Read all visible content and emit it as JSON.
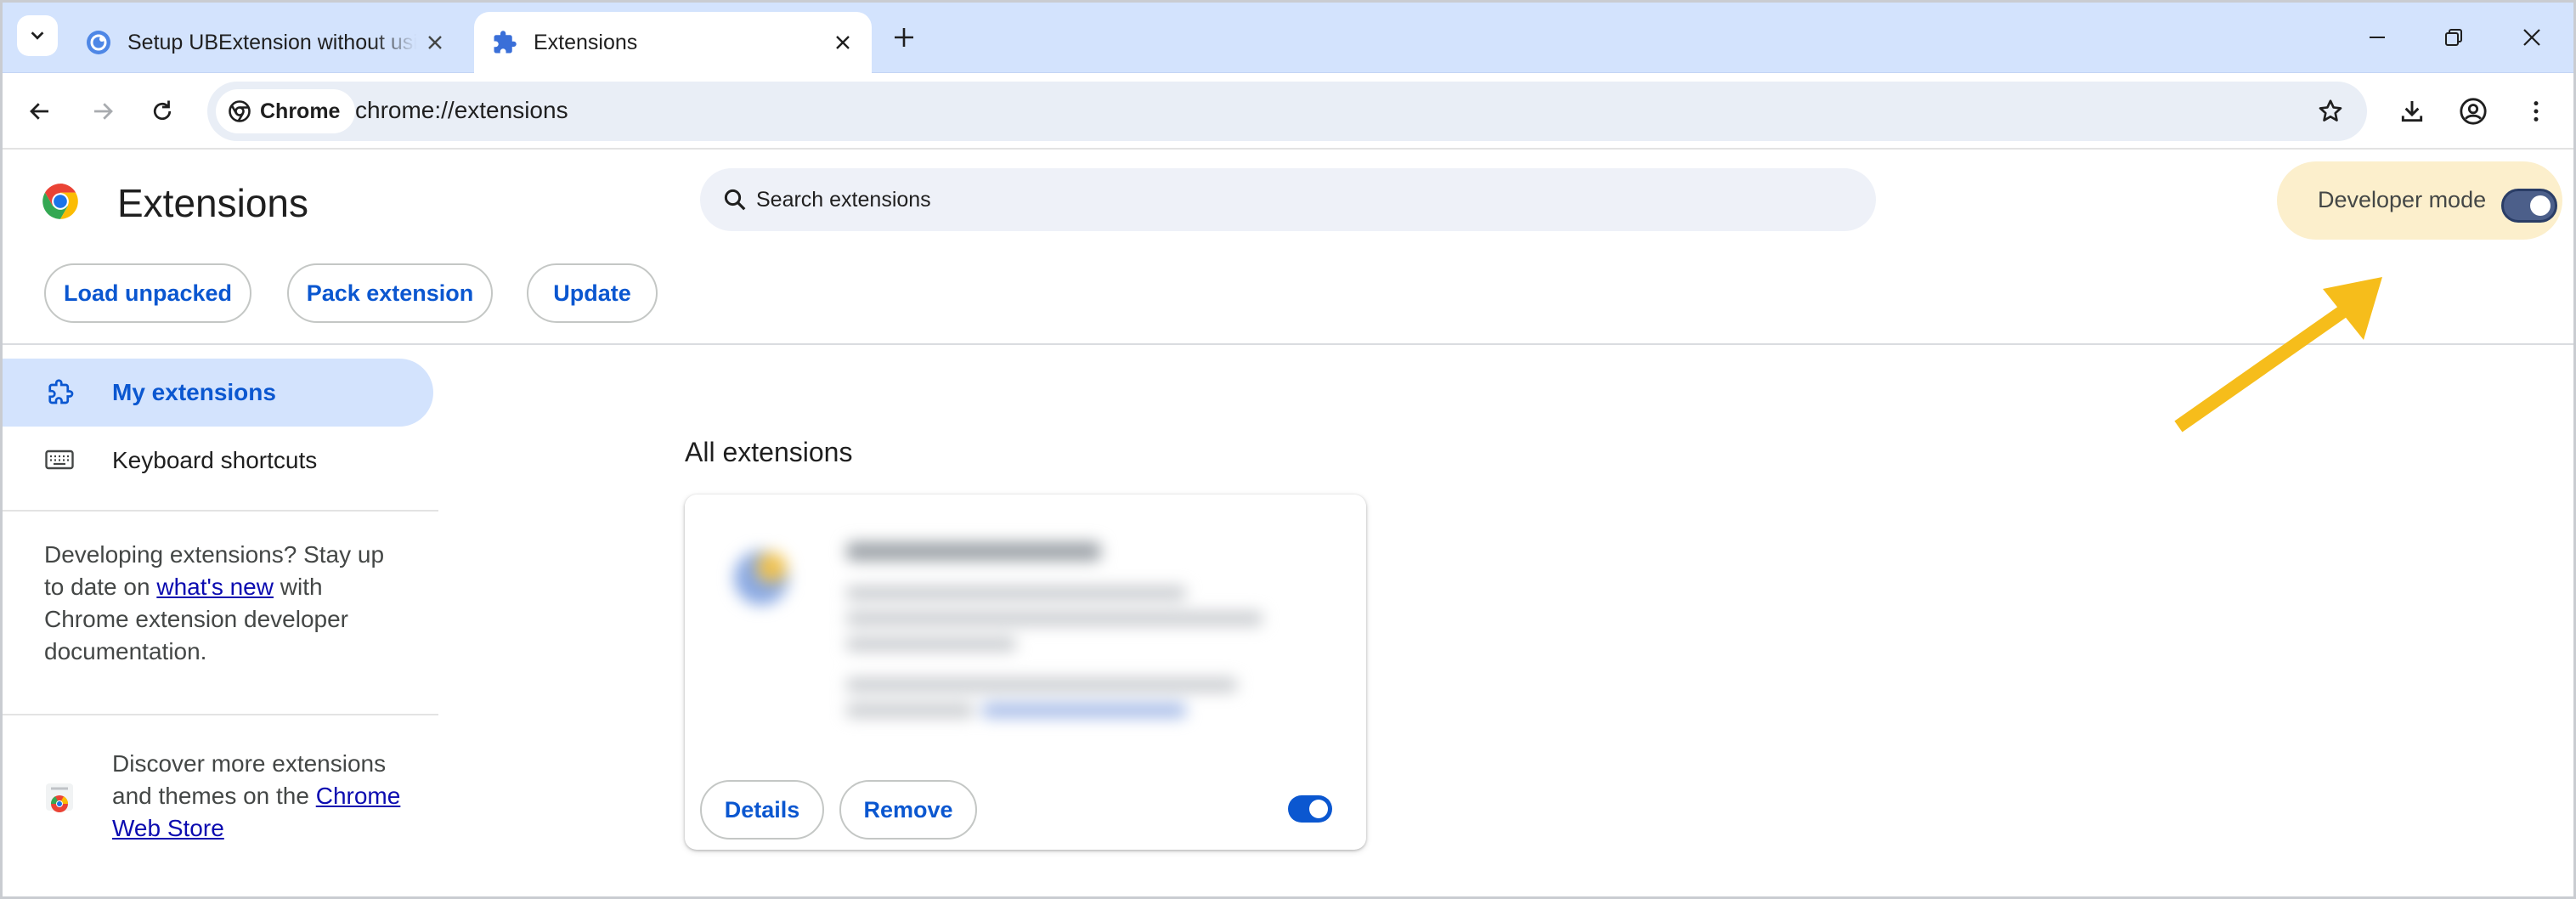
{
  "tabs": [
    {
      "title": "Setup UBExtension without using",
      "favicon": "ubextension-icon",
      "active": false
    },
    {
      "title": "Extensions",
      "favicon": "puzzle-icon",
      "active": true
    }
  ],
  "window_controls": [
    "minimize-icon",
    "restore-icon",
    "close-icon"
  ],
  "toolbar": {
    "chip_label": "Chrome",
    "url": "chrome://extensions"
  },
  "page": {
    "title": "Extensions",
    "search_placeholder": "Search extensions",
    "developer_mode_label": "Developer mode",
    "developer_mode_on": true,
    "buttons": {
      "load_unpacked": "Load unpacked",
      "pack_extension": "Pack extension",
      "update": "Update"
    }
  },
  "sidebar": {
    "items": [
      {
        "label": "My extensions",
        "icon": "puzzle-outline-icon",
        "active": true
      },
      {
        "label": "Keyboard shortcuts",
        "icon": "keyboard-icon",
        "active": false
      }
    ],
    "dev_text_1": "Developing extensions? Stay up to date on",
    "dev_link": "what's new",
    "dev_text_2": "with Chrome extension developer documentation.",
    "store_text": "Discover more extensions and themes on the",
    "store_link": "Chrome Web Store"
  },
  "main": {
    "section_title": "All extensions",
    "card": {
      "details_label": "Details",
      "remove_label": "Remove",
      "enabled": true
    }
  },
  "colors": {
    "accent": "#0b57d0",
    "tabstrip": "#d3e3fd",
    "developer_mode_bg": "#fcefcc",
    "annotation_arrow": "#f6bd1b"
  }
}
